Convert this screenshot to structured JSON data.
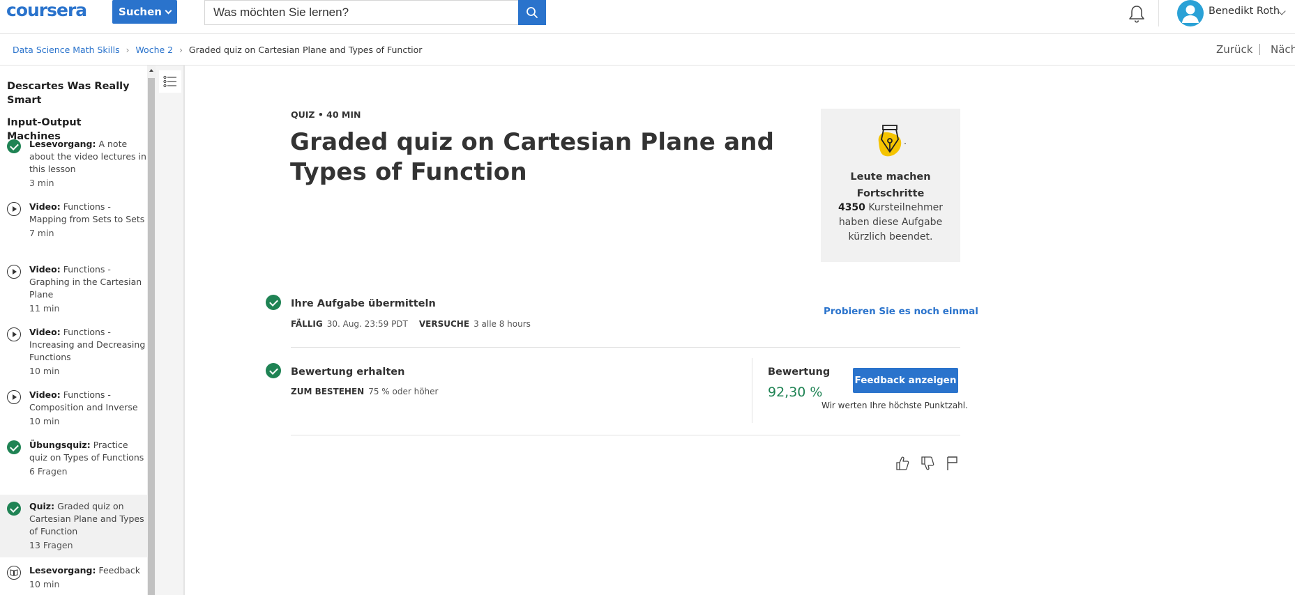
{
  "topbar": {
    "logo": "coursera",
    "search_button": "Suchen",
    "search_placeholder": "Was möchten Sie lernen?",
    "user_name": "Benedikt Roth"
  },
  "breadcrumb": {
    "items": [
      "Data Science Math Skills",
      "Woche 2"
    ],
    "current": "Graded quiz on Cartesian Plane and Types of Functior",
    "back": "Zurück",
    "next": "Näch"
  },
  "sidebar": {
    "lesson_1": "Descartes Was Really Smart",
    "lesson_2": "Input-Output Machines",
    "items": [
      {
        "type": "Lesevorgang:",
        "name": "A note about the video lectures in this lesson",
        "duration": "3 min",
        "status": "completed"
      },
      {
        "type": "Video:",
        "name": "Functions - Mapping from Sets to Sets",
        "duration": "7 min",
        "status": "video"
      },
      {
        "type": "Video:",
        "name": "Functions - Graphing in the Cartesian Plane",
        "duration": "11 min",
        "status": "video"
      },
      {
        "type": "Video:",
        "name": "Functions - Increasing and Decreasing Functions",
        "duration": "10 min",
        "status": "video"
      },
      {
        "type": "Video:",
        "name": "Functions - Composition and Inverse",
        "duration": "10 min",
        "status": "video"
      },
      {
        "type": "Übungsquiz:",
        "name": "Practice quiz on Types of Functions",
        "duration": "6 Fragen",
        "status": "completed"
      },
      {
        "type": "Quiz:",
        "name": "Graded quiz on Cartesian Plane and Types of Function",
        "duration": "13 Fragen",
        "status": "completed"
      },
      {
        "type": "Lesevorgang:",
        "name": "Feedback",
        "duration": "10 min",
        "status": "reading"
      }
    ]
  },
  "main": {
    "meta": "QUIZ • 40 MIN",
    "title": "Graded quiz on Cartesian Plane and Types of Function",
    "progress_card": {
      "title": "Leute machen Fortschritte",
      "count": "4350",
      "text": "Kursteilnehmer haben diese Aufgabe kürzlich beendet."
    },
    "submit": {
      "title": "Ihre Aufgabe übermitteln",
      "due_label": "FÄLLIG",
      "due_value": "30. Aug. 23:59 PDT",
      "attempts_label": "VERSUCHE",
      "attempts_value": "3 alle 8 hours",
      "retry": "Probieren Sie es noch einmal"
    },
    "grade": {
      "title": "Bewertung erhalten",
      "pass_label": "ZUM BESTEHEN",
      "pass_value": "75 % oder höher",
      "grade_label": "Bewertung",
      "grade_value": "92,30 %",
      "feedback_button": "Feedback anzeigen",
      "note": "Wir werten Ihre höchste Punktzahl."
    }
  },
  "colors": {
    "brand": "#2a73cc",
    "success": "#1f8354",
    "accent_yellow": "#f5c400"
  }
}
